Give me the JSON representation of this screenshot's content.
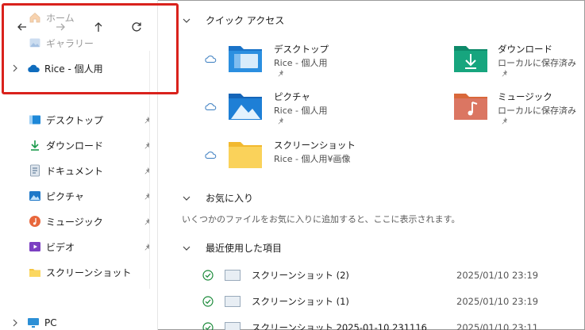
{
  "sidebar": {
    "home_label": "ホーム",
    "gallery_label": "ギャラリー",
    "onedrive_label": "Rice - 個人用",
    "pinned": [
      {
        "label": "デスクトップ",
        "icon": "desktop-icon"
      },
      {
        "label": "ダウンロード",
        "icon": "download-icon"
      },
      {
        "label": "ドキュメント",
        "icon": "document-icon"
      },
      {
        "label": "ピクチャ",
        "icon": "pictures-icon"
      },
      {
        "label": "ミュージック",
        "icon": "music-icon"
      },
      {
        "label": "ビデオ",
        "icon": "video-icon"
      },
      {
        "label": "スクリーンショット",
        "icon": "folder-icon"
      }
    ],
    "pc_label": "PC"
  },
  "sections": {
    "quick_access": "クイック アクセス",
    "favorites": "お気に入り",
    "favorites_empty": "いくつかのファイルをお気に入りに追加すると、ここに表示されます。",
    "recent": "最近使用した項目"
  },
  "quick_access": [
    {
      "name": "デスクトップ",
      "sub": "Rice - 個人用"
    },
    {
      "name": "ダウンロード",
      "sub": "ローカルに保存済み"
    },
    {
      "name": "ピクチャ",
      "sub": "Rice - 個人用"
    },
    {
      "name": "ミュージック",
      "sub": "ローカルに保存済み"
    },
    {
      "name": "スクリーンショット",
      "sub": "Rice - 個人用¥画像"
    }
  ],
  "recent": [
    {
      "name": "スクリーンショット (2)",
      "date": "2025/01/10 23:19"
    },
    {
      "name": "スクリーンショット (1)",
      "date": "2025/01/10 23:19"
    },
    {
      "name": "スクリーンショット 2025-01-10 231116",
      "date": "2025/01/10 23:11"
    }
  ],
  "colors": {
    "highlight": "#d9221c",
    "accent": "#0f6cbd"
  }
}
